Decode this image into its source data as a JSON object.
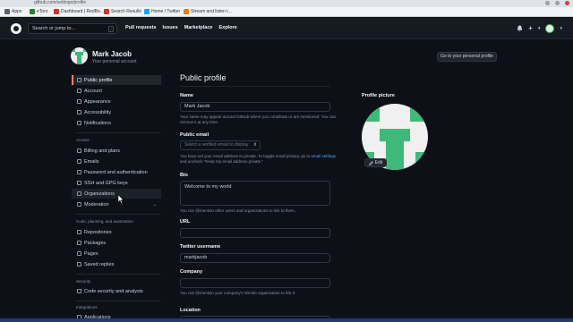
{
  "browser": {
    "url": "github.com/settings/profile",
    "bookmarks": [
      {
        "label": "Apps",
        "color": "#5f6368"
      },
      {
        "label": "eToro",
        "color": "#2e7d32"
      },
      {
        "label": "Dashboard | RedBo...",
        "color": "#c0392b"
      },
      {
        "label": "Search Results",
        "color": "#c0392b"
      },
      {
        "label": "Home / Twitter",
        "color": "#1da1f2"
      },
      {
        "label": "Stream and listen t...",
        "color": "#e67e22"
      }
    ]
  },
  "header": {
    "search_placeholder": "Search or jump to...",
    "search_key": "/",
    "nav": [
      "Pull requests",
      "Issues",
      "Marketplace",
      "Explore"
    ],
    "plus": "+",
    "caret": "▾"
  },
  "profile": {
    "name": "Mark Jacob",
    "subtitle": "Your personal account",
    "goto_button": "Go to your personal profile"
  },
  "sidebar": {
    "items": [
      {
        "label": "Public profile",
        "icon": "person-icon",
        "active": true
      },
      {
        "label": "Account",
        "icon": "gear-icon"
      },
      {
        "label": "Appearance",
        "icon": "paintbrush-icon"
      },
      {
        "label": "Accessibility",
        "icon": "accessibility-icon"
      },
      {
        "label": "Notifications",
        "icon": "bell-icon"
      }
    ],
    "access_heading": "Access",
    "access_items": [
      {
        "label": "Billing and plans",
        "icon": "credit-card-icon"
      },
      {
        "label": "Emails",
        "icon": "mail-icon"
      },
      {
        "label": "Password and authentication",
        "icon": "shield-lock-icon"
      },
      {
        "label": "SSH and GPG keys",
        "icon": "key-icon"
      },
      {
        "label": "Organizations",
        "icon": "organization-icon"
      },
      {
        "label": "Moderation",
        "icon": "report-icon",
        "chevron": "⌄"
      }
    ],
    "code_heading": "Code, planning, and automation",
    "code_items": [
      {
        "label": "Repositories",
        "icon": "repo-icon"
      },
      {
        "label": "Packages",
        "icon": "package-icon"
      },
      {
        "label": "Pages",
        "icon": "browser-icon"
      },
      {
        "label": "Saved replies",
        "icon": "reply-icon"
      }
    ],
    "security_heading": "Security",
    "security_items": [
      {
        "label": "Code security and analysis",
        "icon": "codescan-icon"
      }
    ],
    "integrations_heading": "Integrations",
    "integrations_items": [
      {
        "label": "Applications",
        "icon": "apps-icon"
      }
    ]
  },
  "form": {
    "title": "Public profile",
    "name_label": "Name",
    "name_value": "Mark Jacob",
    "name_note": "Your name may appear around GitHub where you contribute or are mentioned. You can remove it at any time.",
    "email_label": "Public email",
    "email_placeholder": "Select a verified email to display",
    "email_arrow": "⬍",
    "email_note_pre": "You have set your email address to private. To toggle email privacy, go to ",
    "email_note_link": "email settings",
    "email_note_post": " and uncheck \"Keep my email address private.\"",
    "bio_label": "Bio",
    "bio_value": "Welcome to my world",
    "bio_note": "You can @mention other users and organizations to link to them.",
    "url_label": "URL",
    "url_value": "",
    "twitter_label": "Twitter username",
    "twitter_value": "markjacob",
    "company_label": "Company",
    "company_value": "",
    "company_note": "You can @mention your company's GitHub organization to link it.",
    "location_label": "Location"
  },
  "picture": {
    "label": "Profile picture",
    "edit": "Edit",
    "edit_icon": "pencil-icon"
  },
  "colors": {
    "bg": "#0d1117",
    "header": "#161b22",
    "accent": "#f78166",
    "avatar_green": "#3fb97a",
    "link": "#58a6ff"
  }
}
